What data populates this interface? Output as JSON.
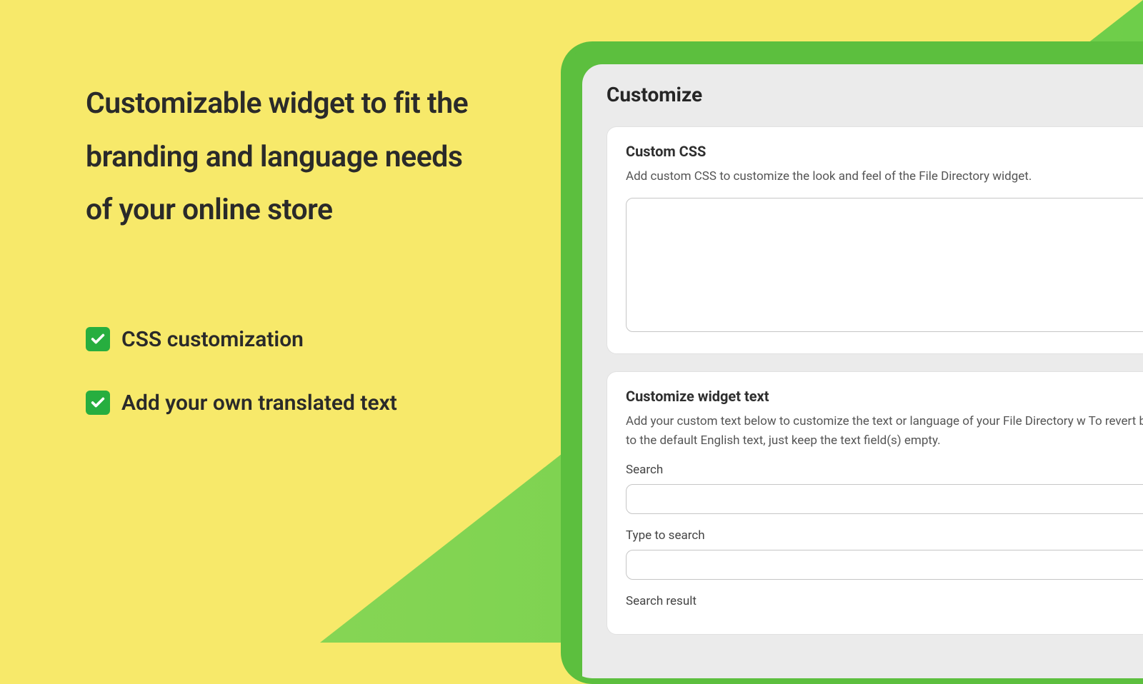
{
  "marketing": {
    "headline": "Customizable widget to fit the branding and language needs of your online store",
    "features": [
      {
        "label": "CSS customization"
      },
      {
        "label": "Add your own translated text"
      }
    ]
  },
  "panel": {
    "title": "Customize",
    "custom_css": {
      "heading": "Custom CSS",
      "description": "Add custom CSS to customize the look and feel of the File Directory widget.",
      "value": ""
    },
    "widget_text": {
      "heading": "Customize widget text",
      "description": "Add your custom text below to customize the text or language of your File Directory w To revert back to the default English text, just keep the text field(s) empty.",
      "fields": {
        "search": {
          "label": "Search",
          "value": ""
        },
        "type_to_search": {
          "label": "Type to search",
          "value": ""
        },
        "search_result": {
          "label": "Search result"
        }
      }
    }
  }
}
